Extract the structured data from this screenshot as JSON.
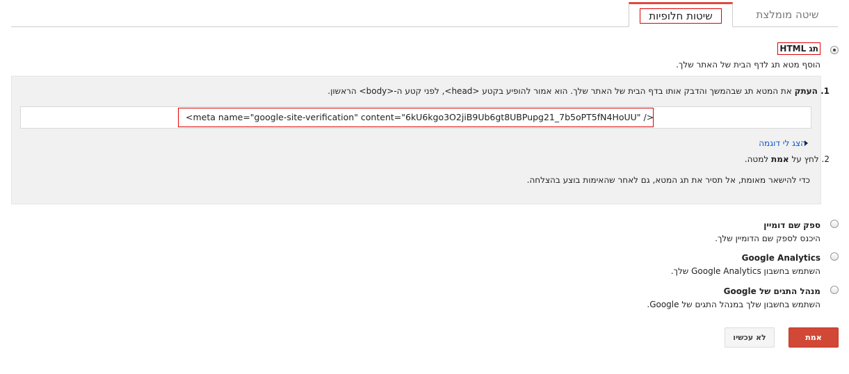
{
  "tabs": {
    "alternate_label": "שיטות חלופיות",
    "recommended_label": "שיטה מומלצת"
  },
  "html_tag": {
    "title": "תג HTML",
    "desc": "הוסף מטא תג לדף הבית של האתר שלך.",
    "step1_bold": "1. העתק",
    "step1_rest": " את המטא תג שבהמשך והדבק אותו בדף הבית של האתר שלך. הוא אמור להופיע בקטע <head>, לפני קטע ה-<body> הראשון.",
    "meta_code": "<meta name=\"google-site-verification\" content=\"6kU6kgo3O2jiB9Ub6gt8UBPupg21_7b5oPT5fN4HoUU\" />",
    "show_example": "הצג לי דוגמה",
    "step2_prefix": "2. לחץ על ",
    "step2_bold": "אמת",
    "step2_suffix": " למטה.",
    "note": "כדי להישאר מאומת, אל תסיר את תג המטא, גם לאחר שהאימות בוצע בהצלחה."
  },
  "options": [
    {
      "title": "ספק שם דומיין",
      "desc": "היכנס לספק שם הדומיין שלך."
    },
    {
      "title": "Google Analytics",
      "desc": "השתמש בחשבון Google Analytics שלך."
    },
    {
      "title": "מנהל התגים של Google",
      "desc": "השתמש בחשבון שלך במנהל התגים של Google."
    }
  ],
  "buttons": {
    "verify": "אמת",
    "not_now": "לא עכשיו"
  },
  "colors": {
    "accent": "#d14836",
    "link": "#1155cc",
    "highlight_border": "#dd0000"
  },
  "icons": [
    "radio-selected-icon",
    "radio-icon",
    "triangle-right-icon"
  ]
}
